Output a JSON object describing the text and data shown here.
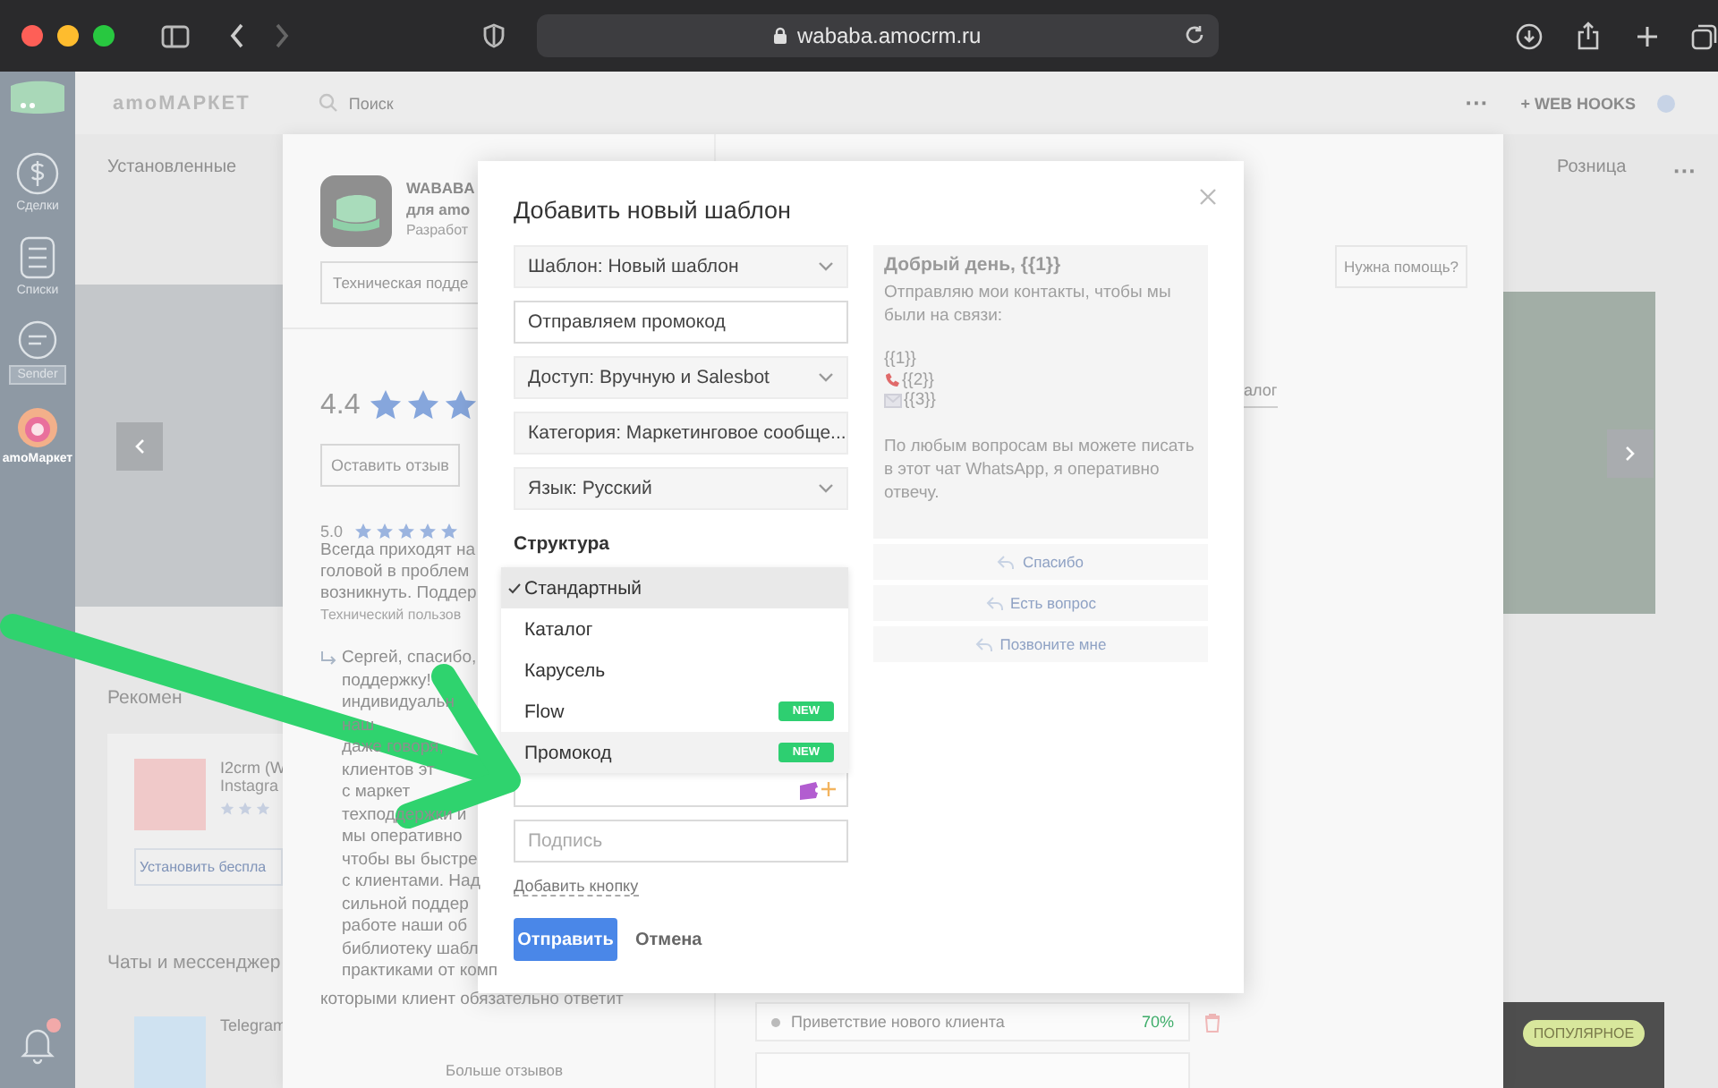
{
  "browser": {
    "url": "wababa.amocrm.ru"
  },
  "nav": {
    "items": [
      {
        "kind": "deals",
        "label": "Сделки",
        "selected": false
      },
      {
        "kind": "lists",
        "label": "Списки",
        "selected": false
      },
      {
        "kind": "sender",
        "label": "Sender",
        "selected": false
      },
      {
        "kind": "market",
        "label": "amoМаркет",
        "selected": true
      }
    ]
  },
  "header": {
    "title": "amoМАРКЕТ",
    "search_placeholder": "Поиск",
    "more": "···",
    "webhooks": "+ WEB HOOKS"
  },
  "market": {
    "tab_left": "Установленные",
    "tab_right": "Розница",
    "tab_more": "···",
    "section_recommended": "Рекомен",
    "card": {
      "name": "I2crm (W",
      "subtitle": "Instagra",
      "stars": 3,
      "install": "Установить беспла"
    },
    "section_chats": "Чаты и мессенджер",
    "card2": {
      "name": "Telegram"
    },
    "popular": "ПОПУЛЯРНОЕ"
  },
  "panel": {
    "app_name": "WABABA",
    "app_sub": "для amo",
    "developer": "Разработ",
    "support": "Техническая подде",
    "rating": {
      "value": "4.4",
      "stars": 3
    },
    "leave_review": "Оставить отзыв",
    "review": {
      "score": "5.0",
      "stars": 5,
      "lines": [
        "Всегда приходят на",
        "головой в проблем",
        "возникнуть. Поддер"
      ],
      "author": "Технический пользов",
      "reply_lines": [
        "Сергей, спасибо,",
        "поддержку!",
        "индивидуальн",
        "наш",
        "даже говоря,",
        "клиентов эт",
        "с маркет",
        "техподдержки и",
        "мы оперативно",
        "чтобы вы быстре",
        "с клиентами. Над",
        "сильной поддер",
        "работе наши об",
        "библиотеку шабл",
        "практиками от комп"
      ],
      "reply_tail": "которыми клиент обязательно ответит"
    },
    "more_reviews": "Больше отзывов",
    "help": "Нужна помощь?",
    "tab_partial": "алог",
    "template_row": {
      "name": "Приветствие нового клиента",
      "percent": "70%"
    }
  },
  "modal": {
    "title": "Добавить новый шаблон",
    "fields": [
      {
        "kind": "select",
        "value": "Шаблон: Новый шаблон"
      },
      {
        "kind": "input",
        "value": "Отправляем промокод"
      },
      {
        "kind": "select",
        "value": "Доступ: Вручную и Salesbot"
      },
      {
        "kind": "select",
        "value": "Категория: Маркетинговое сообще..."
      },
      {
        "kind": "select",
        "value": "Язык: Русский"
      }
    ],
    "structure_label": "Структура",
    "structure_options": [
      {
        "label": "Стандартный",
        "selected": true,
        "hovered": false
      },
      {
        "label": "Каталог",
        "selected": false,
        "hovered": false
      },
      {
        "label": "Карусель",
        "selected": false,
        "hovered": false
      },
      {
        "label": "Flow",
        "selected": false,
        "hovered": false,
        "badge": "NEW"
      },
      {
        "label": "Промокод",
        "selected": false,
        "hovered": true,
        "badge": "NEW"
      }
    ],
    "signature_placeholder": "Подпись",
    "add_button": "Добавить кнопку",
    "submit": "Отправить",
    "cancel": "Отмена",
    "preview": {
      "greeting": "Добрый день, {{1}}",
      "text": "Отправляю мои контакты, чтобы мы были на связи:",
      "vars": [
        {
          "kind": "plain",
          "text": "{{1}}"
        },
        {
          "kind": "phone",
          "text": "{{2}}"
        },
        {
          "kind": "mail",
          "text": "{{3}}"
        }
      ],
      "footer": "По любым вопросам вы можете писать в этот чат WhatsApp, я оперативно отвечу.",
      "buttons": [
        "Спасибо",
        "Есть вопрос",
        "Позвоните мне"
      ]
    }
  }
}
